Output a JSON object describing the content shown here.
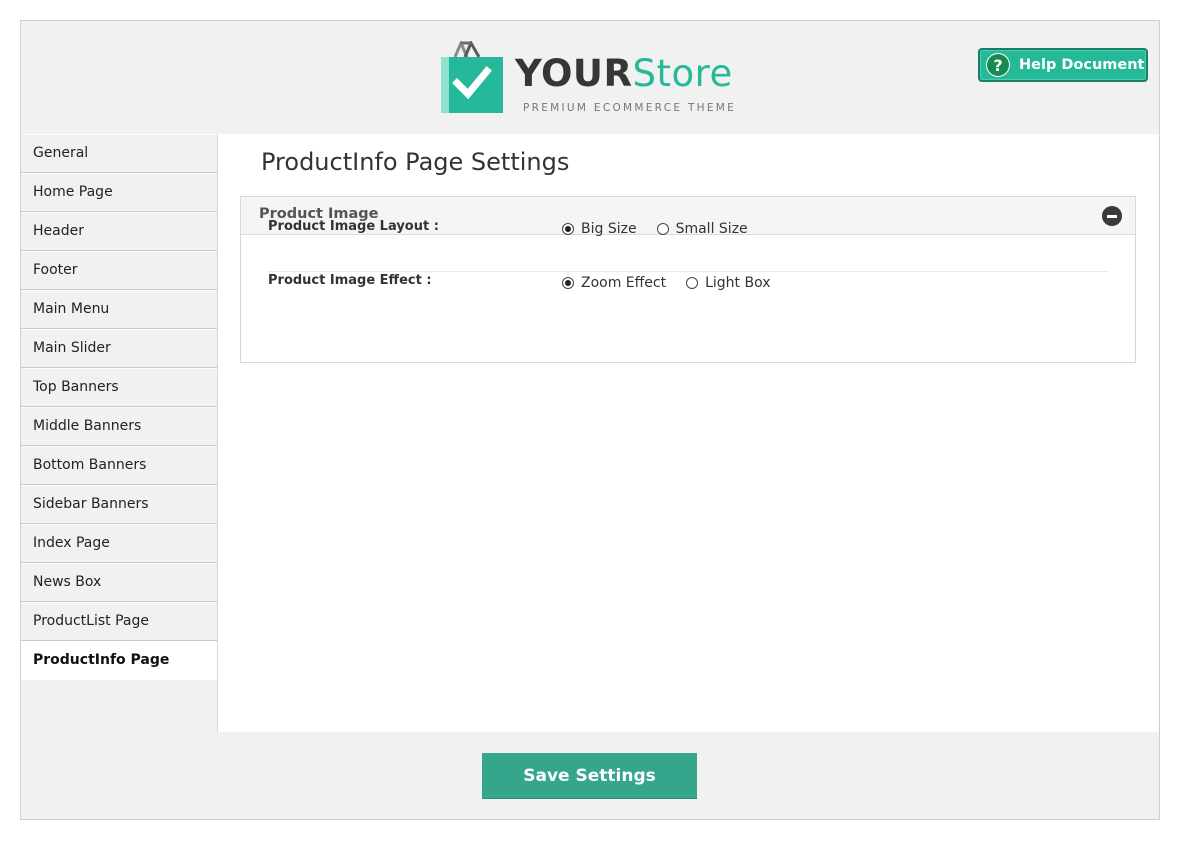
{
  "brand": {
    "name_part1": "YOUR",
    "name_part2": "Store",
    "tagline": "PREMIUM ECOMMERCE THEME",
    "accent_color": "#25b99a"
  },
  "header": {
    "help_label": "Help Document",
    "help_icon": "question-icon"
  },
  "sidebar": {
    "items": [
      {
        "label": "General"
      },
      {
        "label": "Home Page"
      },
      {
        "label": "Header"
      },
      {
        "label": "Footer"
      },
      {
        "label": "Main Menu"
      },
      {
        "label": "Main Slider"
      },
      {
        "label": "Top Banners"
      },
      {
        "label": "Middle Banners"
      },
      {
        "label": "Bottom Banners"
      },
      {
        "label": "Sidebar Banners"
      },
      {
        "label": "Index Page"
      },
      {
        "label": "News Box"
      },
      {
        "label": "ProductList Page"
      },
      {
        "label": "ProductInfo Page",
        "active": true
      }
    ]
  },
  "main": {
    "title": "ProductInfo Page Settings",
    "panel": {
      "title": "Product Image",
      "collapse_icon": "minus-circle-icon",
      "rows": [
        {
          "label": "Product Image Layout :",
          "options": [
            {
              "label": "Big Size",
              "selected": true
            },
            {
              "label": "Small Size",
              "selected": false
            }
          ]
        },
        {
          "label": "Product Image Effect :",
          "options": [
            {
              "label": "Zoom Effect",
              "selected": true
            },
            {
              "label": "Light Box",
              "selected": false
            }
          ]
        }
      ]
    }
  },
  "footer": {
    "save_label": "Save Settings",
    "save_color": "#35a68b"
  }
}
